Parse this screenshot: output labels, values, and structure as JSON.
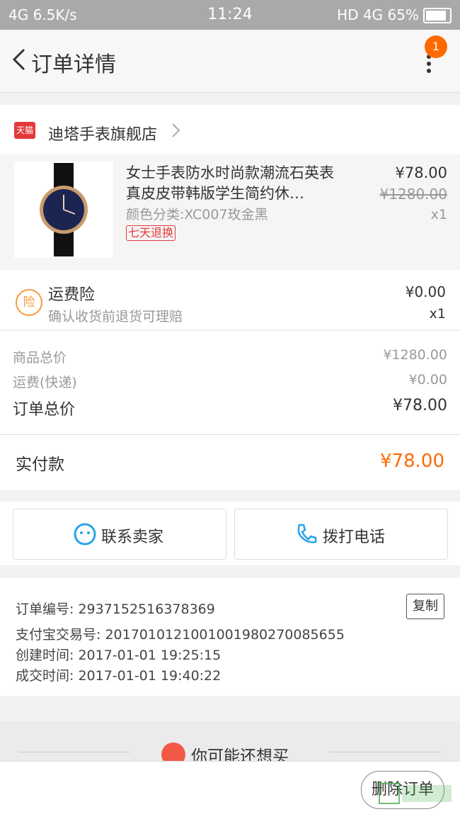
{
  "status": {
    "left": "4G 6.5K/s",
    "time": "11:24",
    "right": "HD 4G 65%"
  },
  "nav": {
    "title": "订单详情",
    "badge": "1"
  },
  "shop": {
    "icon_text": "天猫",
    "name": "迪塔手表旗舰店"
  },
  "product": {
    "title": "女士手表防水时尚款潮流石英表真皮皮带韩版学生简约休…",
    "spec": "颜色分类:XC007玫金黑",
    "tag": "七天退换",
    "price": "¥78.00",
    "original_price": "¥1280.00",
    "qty": "x1"
  },
  "insurance": {
    "icon": "险",
    "title": "运费险",
    "subtitle": "确认收货前退货可理赔",
    "price": "¥0.00",
    "qty": "x1"
  },
  "summary": {
    "goods_label": "商品总价",
    "goods_value": "¥1280.00",
    "shipping_label": "运费(快递)",
    "shipping_value": "¥0.00",
    "order_label": "订单总价",
    "order_value": "¥78.00"
  },
  "paid": {
    "label": "实付款",
    "value": "¥78.00"
  },
  "actions": {
    "contact": "联系卖家",
    "call": "拨打电话"
  },
  "order_info": {
    "order_no": "订单编号: 2937152516378369",
    "alipay_no": "支付宝交易号: 2017010121001001980270085655",
    "created": "创建时间: 2017-01-01 19:25:15",
    "completed": "成交时间: 2017-01-01 19:40:22",
    "copy_label": "复制"
  },
  "recommend": {
    "title": "你可能还想买"
  },
  "bottom": {
    "delete_label": "删除订单"
  },
  "colors": {
    "accent": "#ff6a00",
    "tmall": "#e4393c",
    "link_blue": "#2aa3e8"
  }
}
